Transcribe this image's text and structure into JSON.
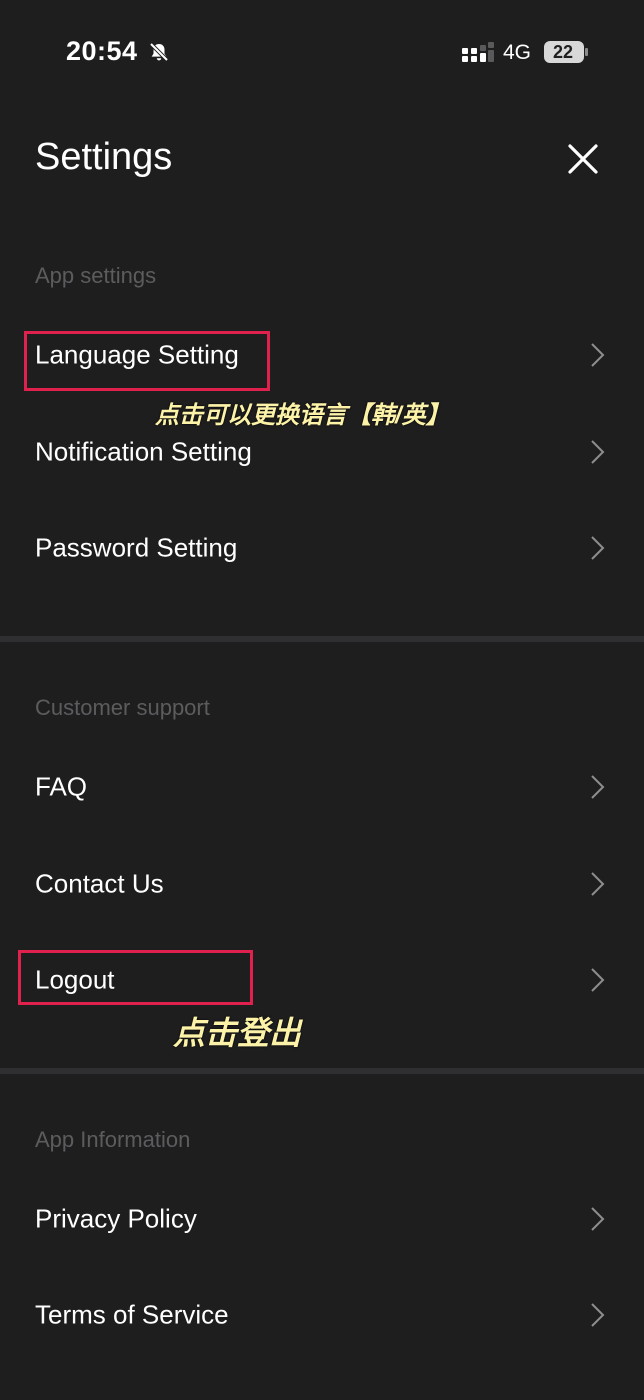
{
  "status_bar": {
    "time": "20:54",
    "network": "4G",
    "battery": "22",
    "icons": [
      "bell-off-icon",
      "signal-icon",
      "battery-icon"
    ]
  },
  "header": {
    "title": "Settings",
    "close_icon": "close-icon"
  },
  "sections": [
    {
      "header": "App settings",
      "items": [
        {
          "label": "Language Setting"
        },
        {
          "label": "Notification Setting"
        },
        {
          "label": "Password Setting"
        }
      ]
    },
    {
      "header": "Customer support",
      "items": [
        {
          "label": "FAQ"
        },
        {
          "label": "Contact Us"
        },
        {
          "label": "Logout"
        }
      ]
    },
    {
      "header": "App Information",
      "items": [
        {
          "label": "Privacy Policy"
        },
        {
          "label": "Terms of Service"
        }
      ]
    }
  ],
  "annotations": {
    "language_note": "点击可以更换语言【韩/英】",
    "logout_note": "点击登出"
  },
  "colors": {
    "background": "#1e1e1f",
    "section_header": "#5c5c5f",
    "divider": "#2f2f31",
    "highlight": "#e0204d",
    "annotation_text": "#fdf3a8"
  }
}
